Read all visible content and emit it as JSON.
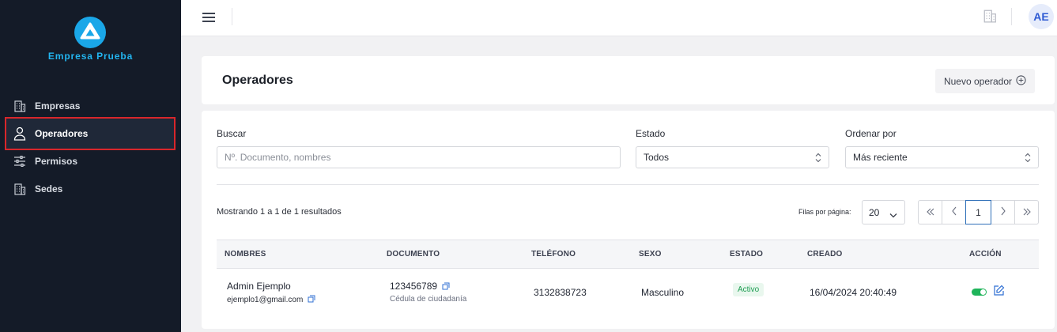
{
  "brand": {
    "name": "Empresa Prueba",
    "colors": {
      "logo": "#1aa7e8",
      "brand_text": "#22b5f0"
    }
  },
  "sidebar": {
    "items": [
      {
        "label": "Empresas",
        "icon": "building-icon",
        "active": false
      },
      {
        "label": "Operadores",
        "icon": "user-icon",
        "active": true
      },
      {
        "label": "Permisos",
        "icon": "sliders-icon",
        "active": false
      },
      {
        "label": "Sedes",
        "icon": "building-icon",
        "active": false
      }
    ]
  },
  "header": {
    "avatar_initials": "AE"
  },
  "page": {
    "title": "Operadores",
    "new_button": "Nuevo operador"
  },
  "filters": {
    "search_label": "Buscar",
    "search_placeholder": "Nº. Documento, nombres",
    "status_label": "Estado",
    "status_value": "Todos",
    "sort_label": "Ordenar por",
    "sort_value": "Más reciente"
  },
  "results": {
    "showing_text": "Mostrando 1  a 1 de  1 resultados",
    "rows_per_page_label": "Filas por página:",
    "rows_per_page": "20",
    "current_page": "1"
  },
  "table": {
    "columns": [
      "NOMBRES",
      "DOCUMENTO",
      "TELÉFONO",
      "SEXO",
      "ESTADO",
      "CREADO",
      "ACCIÓN"
    ],
    "rows": [
      {
        "name": "Admin Ejemplo",
        "email": "ejemplo1@gmail.com",
        "document": "123456789",
        "document_type": "Cédula de ciudadanía",
        "phone": "3132838723",
        "sex": "Masculino",
        "status": "Activo",
        "created": "16/04/2024 20:40:49",
        "enabled": true
      }
    ]
  }
}
